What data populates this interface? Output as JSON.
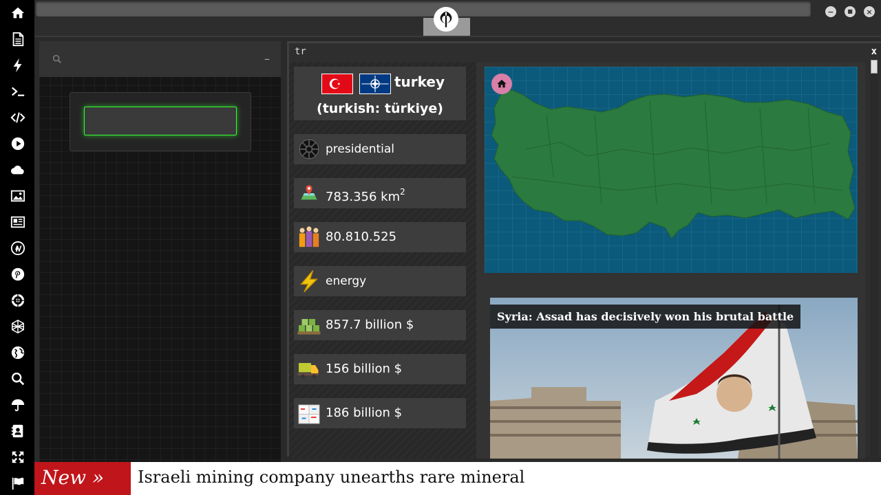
{
  "sidebar": {
    "icons": [
      "home-icon",
      "document-icon",
      "bolt-icon",
      "terminal-icon",
      "code-icon",
      "play-icon",
      "cloud-icon",
      "image-icon",
      "newspaper-icon",
      "wordpress-icon",
      "pinterest-icon",
      "galactic-empire-icon",
      "globe-net-icon",
      "globe-icon",
      "search-icon",
      "umbrella-icon",
      "contacts-icon",
      "expand-icon",
      "flag-icon"
    ]
  },
  "topbar": {
    "logo": "rebel-alliance-icon",
    "window_controls": [
      "minimize",
      "maximize",
      "close"
    ],
    "minimize_glyph": "−",
    "maximize_glyph": "■",
    "close_glyph": "×"
  },
  "search_panel": {
    "collapse_glyph": "–",
    "input_value": ""
  },
  "window": {
    "title": "tr",
    "close_glyph": "x"
  },
  "country": {
    "name": "turkey",
    "native": "(turkish: türkiye)",
    "government": "presidential",
    "area": "783.356 km",
    "area_sup": "2",
    "population": "80.810.525",
    "resource": "energy",
    "gdp": "857.7 billion $",
    "exports": "156 billion $",
    "imports": "186 billion $"
  },
  "news": {
    "headline": "Syria: Assad has decisively won his brutal battle"
  },
  "ticker": {
    "label": "New »",
    "text": "Israeli mining company unearths rare mineral"
  },
  "colors": {
    "accent_green": "#33ff33",
    "map_sea": "#0b5a7c",
    "map_land": "#2b7a3f",
    "ticker_red": "#c0151a",
    "home_pink": "#d97fa8"
  }
}
